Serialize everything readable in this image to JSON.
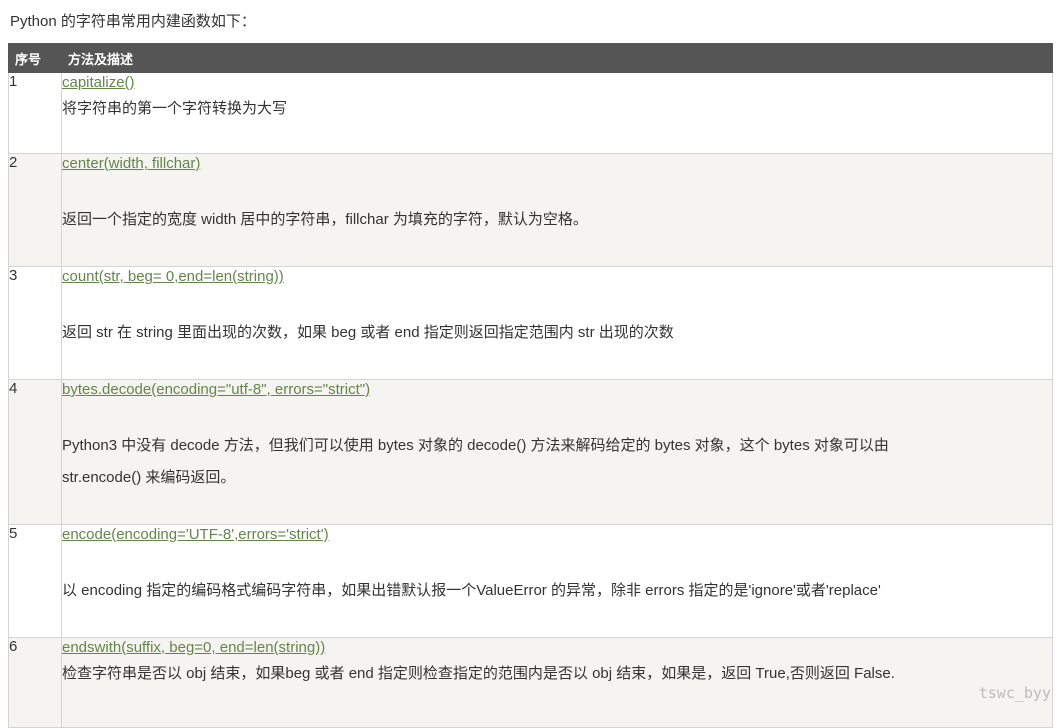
{
  "intro": "Python 的字符串常用内建函数如下：",
  "table": {
    "headers": {
      "num": "序号",
      "desc": "方法及描述"
    },
    "rows": [
      {
        "num": "1",
        "method": "capitalize()",
        "desc": "将字符串的第一个字符转换为大写",
        "gap": "small"
      },
      {
        "num": "2",
        "method": "center(width, fillchar)",
        "desc": "返回一个指定的宽度 width 居中的字符串，fillchar 为填充的字符，默认为空格。",
        "gap": "large"
      },
      {
        "num": "3",
        "method": "count(str, beg= 0,end=len(string))",
        "desc": "返回 str 在 string 里面出现的次数，如果 beg 或者 end 指定则返回指定范围内 str 出现的次数",
        "gap": "large"
      },
      {
        "num": "4",
        "method": "bytes.decode(encoding=\"utf-8\", errors=\"strict\")",
        "desc": "Python3 中没有 decode 方法，但我们可以使用 bytes 对象的 decode() 方法来解码给定的 bytes 对象，这个 bytes 对象可以由",
        "desc2": "str.encode() 来编码返回。",
        "gap": "large"
      },
      {
        "num": "5",
        "method": "encode(encoding='UTF-8',errors='strict')",
        "desc": "以 encoding 指定的编码格式编码字符串，如果出错默认报一个ValueError 的异常，除非 errors 指定的是'ignore'或者'replace'",
        "gap": "large"
      },
      {
        "num": "6",
        "method": "endswith(suffix, beg=0, end=len(string))",
        "desc": "检查字符串是否以 obj 结束，如果beg 或者 end 指定则检查指定的范围内是否以 obj 结束，如果是，返回 True,否则返回 False.",
        "gap": "none"
      }
    ]
  },
  "watermark": "tswc_byy"
}
